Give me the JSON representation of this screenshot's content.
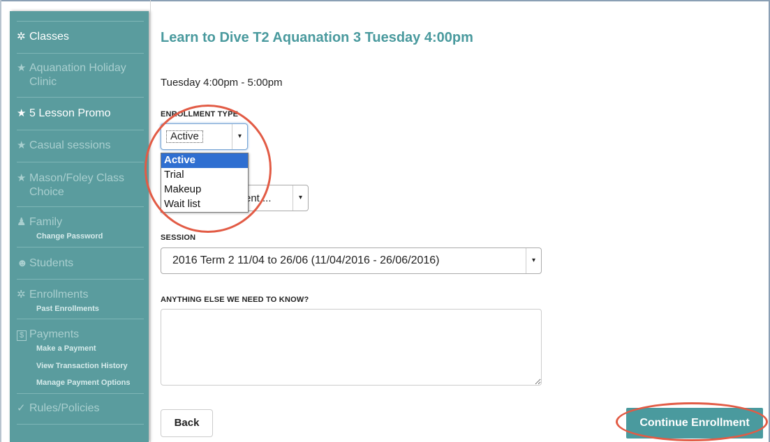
{
  "sidebar": {
    "items": [
      {
        "icon": "people-icon",
        "glyph": "✲",
        "label": "Classes"
      },
      {
        "icon": "star-icon",
        "glyph": "★",
        "label": "Aquanation Holiday Clinic"
      },
      {
        "icon": "star-icon",
        "glyph": "★",
        "label": "5 Lesson Promo"
      },
      {
        "icon": "star-icon",
        "glyph": "★",
        "label": "Casual sessions"
      },
      {
        "icon": "star-icon",
        "glyph": "★",
        "label": "Mason/Foley Class Choice"
      },
      {
        "icon": "family-icon",
        "glyph": "♟",
        "label": "Family",
        "sub": [
          "Change Password"
        ]
      },
      {
        "icon": "student-icon",
        "glyph": "☻",
        "label": "Students"
      },
      {
        "icon": "people-icon",
        "glyph": "✲",
        "label": "Enrollments",
        "sub": [
          "Past Enrollments"
        ]
      },
      {
        "icon": "dollar-icon",
        "glyph": "$",
        "label": "Payments",
        "sub": [
          "Make a Payment",
          "View Transaction History",
          "Manage Payment Options"
        ]
      },
      {
        "icon": "check-icon",
        "glyph": "✓",
        "label": "Rules/Policies"
      }
    ]
  },
  "main": {
    "title": "Learn to Dive T2 Aquanation 3 Tuesday 4:00pm",
    "schedule": "Tuesday 4:00pm - 5:00pm",
    "enrollment_type": {
      "label": "ENROLLMENT TYPE",
      "value": "Active",
      "options": [
        "Active",
        "Trial",
        "Makeup",
        "Wait list"
      ]
    },
    "student": {
      "value": "ent ..."
    },
    "session": {
      "label": "SESSION",
      "value": "2016 Term 2 11/04 to 26/06 (11/04/2016 - 26/06/2016)"
    },
    "notes": {
      "label": "ANYTHING ELSE WE NEED TO KNOW?",
      "value": ""
    },
    "back_label": "Back",
    "continue_label": "Continue Enrollment"
  },
  "colors": {
    "sidebar_bg": "#5a9c9e",
    "accent": "#4a9a9e",
    "highlight": "#2f6fd1",
    "annotation": "#e25b45"
  }
}
